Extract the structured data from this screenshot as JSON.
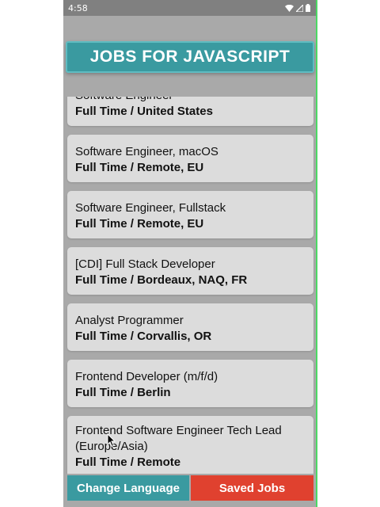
{
  "status_bar": {
    "time": "4:58",
    "icons": [
      "wifi-icon",
      "signal-icon",
      "battery-icon"
    ]
  },
  "header": {
    "title": "JOBS FOR JAVASCRIPT"
  },
  "jobs": [
    {
      "title": "Software Engineer",
      "subtitle": "Full Time / United States"
    },
    {
      "title": "Software Engineer, macOS",
      "subtitle": "Full Time / Remote, EU"
    },
    {
      "title": "Software Engineer, Fullstack",
      "subtitle": "Full Time / Remote, EU"
    },
    {
      "title": "[CDI] Full Stack Developer",
      "subtitle": "Full Time / Bordeaux, NAQ, FR"
    },
    {
      "title": "Analyst Programmer",
      "subtitle": "Full Time / Corvallis, OR"
    },
    {
      "title": "Frontend Developer (m/f/d)",
      "subtitle": "Full Time / Berlin"
    },
    {
      "title": "Frontend Software Engineer Tech Lead (Europe/Asia)",
      "subtitle": "Full Time / Remote"
    }
  ],
  "bottom_bar": {
    "change_language_label": "Change Language",
    "saved_jobs_label": "Saved Jobs"
  },
  "colors": {
    "accent": "#3a9aa0",
    "danger": "#e0412f",
    "background": "#a9a9a9",
    "card": "#dcdcdc"
  }
}
